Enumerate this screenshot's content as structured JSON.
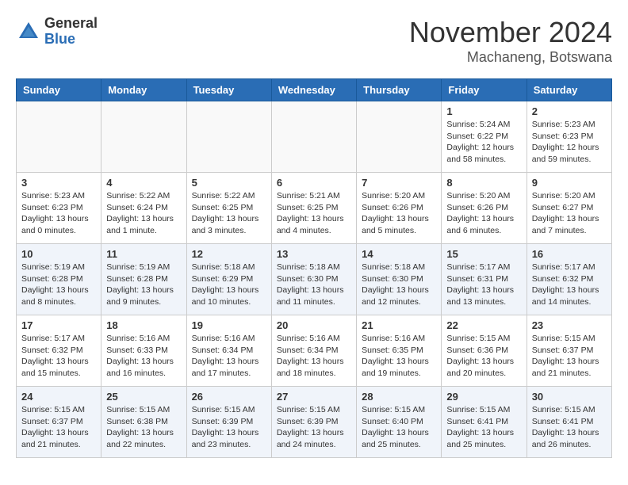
{
  "logo": {
    "general": "General",
    "blue": "Blue"
  },
  "title": "November 2024",
  "location": "Machaneng, Botswana",
  "days_of_week": [
    "Sunday",
    "Monday",
    "Tuesday",
    "Wednesday",
    "Thursday",
    "Friday",
    "Saturday"
  ],
  "weeks": [
    {
      "shaded": false,
      "days": [
        {
          "num": "",
          "info": ""
        },
        {
          "num": "",
          "info": ""
        },
        {
          "num": "",
          "info": ""
        },
        {
          "num": "",
          "info": ""
        },
        {
          "num": "",
          "info": ""
        },
        {
          "num": "1",
          "info": "Sunrise: 5:24 AM\nSunset: 6:22 PM\nDaylight: 12 hours\nand 58 minutes."
        },
        {
          "num": "2",
          "info": "Sunrise: 5:23 AM\nSunset: 6:23 PM\nDaylight: 12 hours\nand 59 minutes."
        }
      ]
    },
    {
      "shaded": false,
      "days": [
        {
          "num": "3",
          "info": "Sunrise: 5:23 AM\nSunset: 6:23 PM\nDaylight: 13 hours\nand 0 minutes."
        },
        {
          "num": "4",
          "info": "Sunrise: 5:22 AM\nSunset: 6:24 PM\nDaylight: 13 hours\nand 1 minute."
        },
        {
          "num": "5",
          "info": "Sunrise: 5:22 AM\nSunset: 6:25 PM\nDaylight: 13 hours\nand 3 minutes."
        },
        {
          "num": "6",
          "info": "Sunrise: 5:21 AM\nSunset: 6:25 PM\nDaylight: 13 hours\nand 4 minutes."
        },
        {
          "num": "7",
          "info": "Sunrise: 5:20 AM\nSunset: 6:26 PM\nDaylight: 13 hours\nand 5 minutes."
        },
        {
          "num": "8",
          "info": "Sunrise: 5:20 AM\nSunset: 6:26 PM\nDaylight: 13 hours\nand 6 minutes."
        },
        {
          "num": "9",
          "info": "Sunrise: 5:20 AM\nSunset: 6:27 PM\nDaylight: 13 hours\nand 7 minutes."
        }
      ]
    },
    {
      "shaded": true,
      "days": [
        {
          "num": "10",
          "info": "Sunrise: 5:19 AM\nSunset: 6:28 PM\nDaylight: 13 hours\nand 8 minutes."
        },
        {
          "num": "11",
          "info": "Sunrise: 5:19 AM\nSunset: 6:28 PM\nDaylight: 13 hours\nand 9 minutes."
        },
        {
          "num": "12",
          "info": "Sunrise: 5:18 AM\nSunset: 6:29 PM\nDaylight: 13 hours\nand 10 minutes."
        },
        {
          "num": "13",
          "info": "Sunrise: 5:18 AM\nSunset: 6:30 PM\nDaylight: 13 hours\nand 11 minutes."
        },
        {
          "num": "14",
          "info": "Sunrise: 5:18 AM\nSunset: 6:30 PM\nDaylight: 13 hours\nand 12 minutes."
        },
        {
          "num": "15",
          "info": "Sunrise: 5:17 AM\nSunset: 6:31 PM\nDaylight: 13 hours\nand 13 minutes."
        },
        {
          "num": "16",
          "info": "Sunrise: 5:17 AM\nSunset: 6:32 PM\nDaylight: 13 hours\nand 14 minutes."
        }
      ]
    },
    {
      "shaded": false,
      "days": [
        {
          "num": "17",
          "info": "Sunrise: 5:17 AM\nSunset: 6:32 PM\nDaylight: 13 hours\nand 15 minutes."
        },
        {
          "num": "18",
          "info": "Sunrise: 5:16 AM\nSunset: 6:33 PM\nDaylight: 13 hours\nand 16 minutes."
        },
        {
          "num": "19",
          "info": "Sunrise: 5:16 AM\nSunset: 6:34 PM\nDaylight: 13 hours\nand 17 minutes."
        },
        {
          "num": "20",
          "info": "Sunrise: 5:16 AM\nSunset: 6:34 PM\nDaylight: 13 hours\nand 18 minutes."
        },
        {
          "num": "21",
          "info": "Sunrise: 5:16 AM\nSunset: 6:35 PM\nDaylight: 13 hours\nand 19 minutes."
        },
        {
          "num": "22",
          "info": "Sunrise: 5:15 AM\nSunset: 6:36 PM\nDaylight: 13 hours\nand 20 minutes."
        },
        {
          "num": "23",
          "info": "Sunrise: 5:15 AM\nSunset: 6:37 PM\nDaylight: 13 hours\nand 21 minutes."
        }
      ]
    },
    {
      "shaded": true,
      "days": [
        {
          "num": "24",
          "info": "Sunrise: 5:15 AM\nSunset: 6:37 PM\nDaylight: 13 hours\nand 21 minutes."
        },
        {
          "num": "25",
          "info": "Sunrise: 5:15 AM\nSunset: 6:38 PM\nDaylight: 13 hours\nand 22 minutes."
        },
        {
          "num": "26",
          "info": "Sunrise: 5:15 AM\nSunset: 6:39 PM\nDaylight: 13 hours\nand 23 minutes."
        },
        {
          "num": "27",
          "info": "Sunrise: 5:15 AM\nSunset: 6:39 PM\nDaylight: 13 hours\nand 24 minutes."
        },
        {
          "num": "28",
          "info": "Sunrise: 5:15 AM\nSunset: 6:40 PM\nDaylight: 13 hours\nand 25 minutes."
        },
        {
          "num": "29",
          "info": "Sunrise: 5:15 AM\nSunset: 6:41 PM\nDaylight: 13 hours\nand 25 minutes."
        },
        {
          "num": "30",
          "info": "Sunrise: 5:15 AM\nSunset: 6:41 PM\nDaylight: 13 hours\nand 26 minutes."
        }
      ]
    }
  ]
}
